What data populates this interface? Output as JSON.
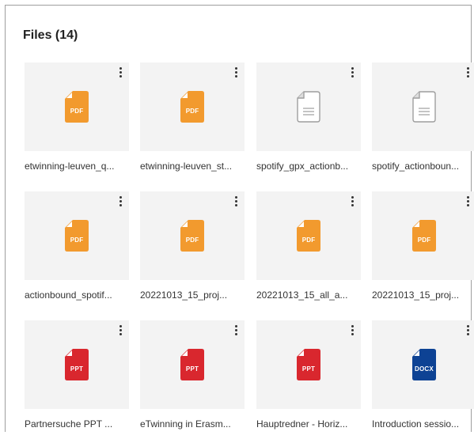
{
  "header": {
    "title": "Files (14)"
  },
  "colors": {
    "pdf": "#f29a2e",
    "ppt": "#d9272e",
    "docx": "#0d4294",
    "generic_stroke": "#9e9e9e"
  },
  "files": [
    {
      "name": "etwinning-leuven_q...",
      "type": "pdf",
      "badge": "PDF",
      "icon": "pdf-file-icon"
    },
    {
      "name": "etwinning-leuven_st...",
      "type": "pdf",
      "badge": "PDF",
      "icon": "pdf-file-icon"
    },
    {
      "name": "spotify_gpx_actionb...",
      "type": "generic",
      "badge": "",
      "icon": "generic-file-icon"
    },
    {
      "name": "spotify_actionboun...",
      "type": "generic",
      "badge": "",
      "icon": "generic-file-icon"
    },
    {
      "name": "actionbound_spotif...",
      "type": "pdf",
      "badge": "PDF",
      "icon": "pdf-file-icon"
    },
    {
      "name": "20221013_15_proj...",
      "type": "pdf",
      "badge": "PDF",
      "icon": "pdf-file-icon"
    },
    {
      "name": "20221013_15_all_a...",
      "type": "pdf",
      "badge": "PDF",
      "icon": "pdf-file-icon"
    },
    {
      "name": "20221013_15_proj...",
      "type": "pdf",
      "badge": "PDF",
      "icon": "pdf-file-icon"
    },
    {
      "name": "Partnersuche PPT ...",
      "type": "ppt",
      "badge": "PPT",
      "icon": "ppt-file-icon"
    },
    {
      "name": "eTwinning in Erasm...",
      "type": "ppt",
      "badge": "PPT",
      "icon": "ppt-file-icon"
    },
    {
      "name": "Hauptredner - Horiz...",
      "type": "ppt",
      "badge": "PPT",
      "icon": "ppt-file-icon"
    },
    {
      "name": "Introduction sessio...",
      "type": "docx",
      "badge": "DOCX",
      "icon": "docx-file-icon"
    }
  ]
}
